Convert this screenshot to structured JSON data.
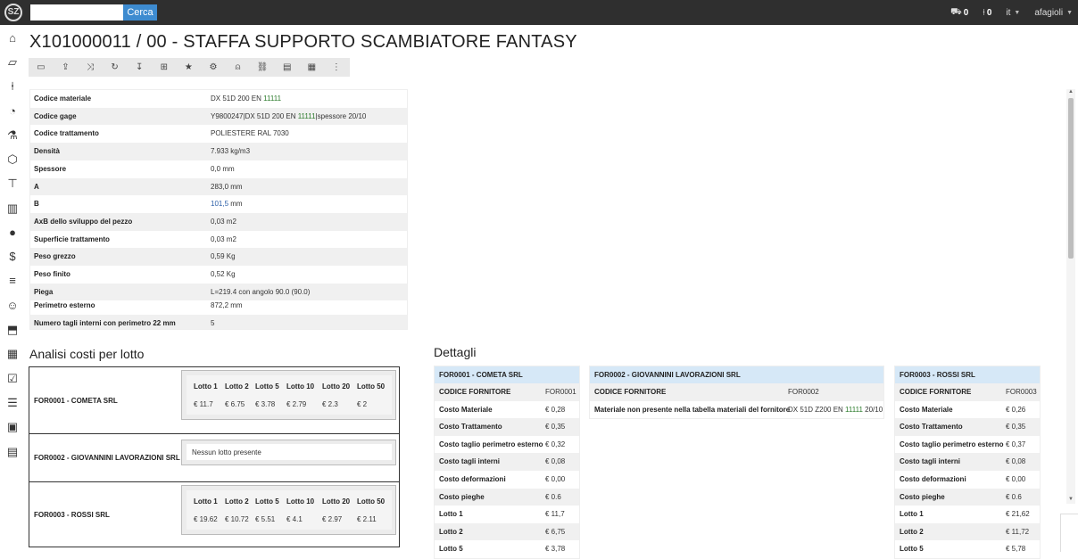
{
  "topbar": {
    "logo_text": "SZ",
    "search_value": "",
    "search_button": "Cerca",
    "cart_count": "0",
    "pin_count": "0",
    "language": "it",
    "user": "afagioli"
  },
  "page": {
    "title": "X101000011 / 00 - STAFFA SUPPORTO SCAMBIATORE FANTASY"
  },
  "toolbar": {
    "icons": [
      "monitor-icon",
      "upload-icon",
      "shuffle-icon",
      "share-icon",
      "pin-icon",
      "hierarchy-icon",
      "star-icon",
      "gear-icon",
      "user-icon",
      "link-icon",
      "clipboard-icon",
      "calendar-icon",
      "more-icon"
    ],
    "glyphs": [
      "▭",
      "⇪",
      "⤨",
      "↻",
      "↧",
      "⊞",
      "★",
      "⚙",
      "⍝",
      "⛓",
      "▤",
      "▦",
      "⋮"
    ]
  },
  "properties": [
    {
      "label": "Codice materiale",
      "value_pre": "DX 51D 200 EN ",
      "value_hl": "11111",
      "value_post": ""
    },
    {
      "label": "Codice gage",
      "value_pre": "Y9800247|DX 51D 200 EN ",
      "value_hl": "11111",
      "value_post": "|spessore 20/10"
    },
    {
      "label": "Codice trattamento",
      "value_pre": "POLIESTERE RAL 7030",
      "value_hl": "",
      "value_post": ""
    },
    {
      "label": "Densità",
      "value_pre": "7.933 kg/m3",
      "value_hl": "",
      "value_post": ""
    },
    {
      "label": "Spessore",
      "value_pre": "0,0 mm",
      "value_hl": "",
      "value_post": ""
    },
    {
      "label": "A",
      "value_pre": "283,0 mm",
      "value_hl": "",
      "value_post": ""
    },
    {
      "label": "B",
      "value_pre": "",
      "value_hl": "101,5",
      "value_post": " mm"
    },
    {
      "label": "AxB dello sviluppo del pezzo",
      "value_pre": "0,03 m2",
      "value_hl": "",
      "value_post": ""
    },
    {
      "label": "Superficie trattamento",
      "value_pre": "0,03 m2",
      "value_hl": "",
      "value_post": ""
    },
    {
      "label": "Peso grezzo",
      "value_pre": "0,59 Kg",
      "value_hl": "",
      "value_post": ""
    },
    {
      "label": "Peso finito",
      "value_pre": "0,52 Kg",
      "value_hl": "",
      "value_post": ""
    },
    {
      "label": "Piega",
      "value_pre": "L=219.4 con angolo 90.0 (90.0)",
      "value_hl": "",
      "value_post": ""
    },
    {
      "label": "Perimetro esterno",
      "value_pre": "872,2 mm",
      "value_hl": "",
      "value_post": ""
    },
    {
      "label": "Numero tagli interni con perimetro 22 mm",
      "value_pre": "5",
      "value_hl": "",
      "value_post": ""
    }
  ],
  "analisi": {
    "title": "Analisi costi per lotto",
    "rows": [
      {
        "supplier": "FOR0001 - COMETA SRL",
        "headers": [
          "Lotto 1",
          "Lotto 2",
          "Lotto 5",
          "Lotto 10",
          "Lotto 20",
          "Lotto 50"
        ],
        "values": [
          "€ 11.7",
          "€ 6.75",
          "€ 3.78",
          "€ 2.79",
          "€ 2.3",
          "€ 2"
        ]
      },
      {
        "supplier": "FOR0002 - GIOVANNINI LAVORAZIONI SRL",
        "empty_message": "Nessun lotto presente"
      },
      {
        "supplier": "FOR0003 - ROSSI SRL",
        "headers": [
          "Lotto 1",
          "Lotto 2",
          "Lotto 5",
          "Lotto 10",
          "Lotto 20",
          "Lotto 50"
        ],
        "values": [
          "€ 19.62",
          "€ 10.72",
          "€ 5.51",
          "€ 4.1",
          "€ 2.97",
          "€ 2.11"
        ]
      }
    ]
  },
  "dettagli": {
    "title": "Dettagli",
    "cards": [
      {
        "header": "FOR0001 - COMETA SRL",
        "rows": [
          {
            "label": "CODICE FORNITORE",
            "value": "FOR0001"
          },
          {
            "label": "Costo Materiale",
            "value": "€ 0,28"
          },
          {
            "label": "Costo Trattamento",
            "value": "€ 0,35"
          },
          {
            "label": "Costo taglio perimetro esterno",
            "value": "€ 0,32"
          },
          {
            "label": "Costo tagli interni",
            "value": "€ 0,08"
          },
          {
            "label": "Costo deformazioni",
            "value": "€ 0,00"
          },
          {
            "label": "Costo pieghe",
            "value": "€ 0.6"
          },
          {
            "label": "Lotto 1",
            "value": "€ 11,7"
          },
          {
            "label": "Lotto 2",
            "value": "€ 6,75"
          },
          {
            "label": "Lotto 5",
            "value": "€ 3,78"
          }
        ]
      },
      {
        "header": "FOR0002 - GIOVANNINI LAVORAZIONI SRL",
        "rows": [
          {
            "label": "CODICE FORNITORE",
            "value": "FOR0002"
          },
          {
            "label": "Materiale non presente nella tabella materiali del fornitore",
            "value_pre": "DX 51D Z200 EN ",
            "value_hl": "11111",
            "value_post": " 20/10"
          }
        ]
      },
      {
        "header": "FOR0003 - ROSSI SRL",
        "rows": [
          {
            "label": "CODICE FORNITORE",
            "value": "FOR0003"
          },
          {
            "label": "Costo Materiale",
            "value": "€ 0,26"
          },
          {
            "label": "Costo Trattamento",
            "value": "€ 0,35"
          },
          {
            "label": "Costo taglio perimetro esterno",
            "value": "€ 0,37"
          },
          {
            "label": "Costo tagli interni",
            "value": "€ 0,08"
          },
          {
            "label": "Costo deformazioni",
            "value": "€ 0,00"
          },
          {
            "label": "Costo pieghe",
            "value": "€ 0.6"
          },
          {
            "label": "Lotto 1",
            "value": "€ 21,62"
          },
          {
            "label": "Lotto 2",
            "value": "€ 11,72"
          },
          {
            "label": "Lotto 5",
            "value": "€ 5,78"
          }
        ]
      }
    ]
  },
  "sidebar": {
    "icons": [
      "home-icon",
      "folder-icon",
      "pin-icon",
      "clock-icon",
      "flask-icon",
      "box-icon",
      "sitemap-icon",
      "building-icon",
      "user-icon",
      "dollar-icon",
      "bars-icon",
      "support-icon",
      "tag-icon",
      "calendar-icon",
      "checklist-icon",
      "list-icon",
      "report-icon",
      "document-icon"
    ],
    "glyphs": [
      "⌂",
      "▱",
      "⍿",
      "◔",
      "⚗",
      "⬡",
      "⊤",
      "▥",
      "●",
      "$",
      "≡",
      "☺",
      "⬒",
      "▦",
      "☑",
      "☰",
      "▣",
      "▤"
    ]
  },
  "colors": {
    "topbar": "#2f2f2f",
    "accent": "#3d8bd0",
    "card_header": "#d6e8f7",
    "highlight_green": "#2a7a2a"
  }
}
